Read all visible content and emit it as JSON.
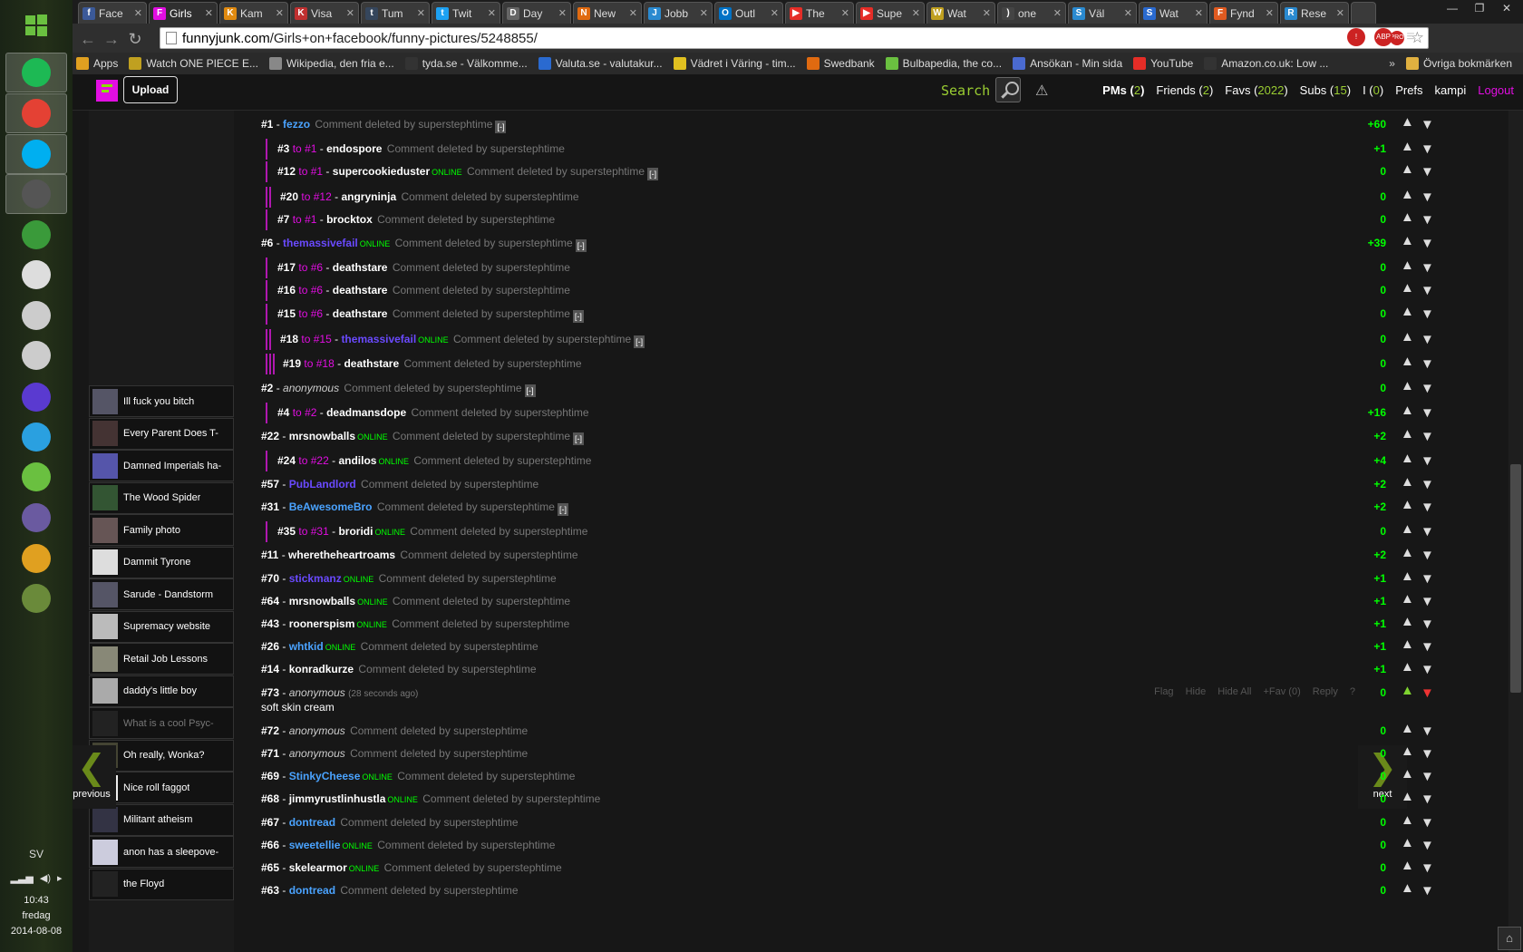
{
  "taskbar": {
    "lang": "SV",
    "time": "10:43",
    "day": "fredag",
    "date": "2014-08-08",
    "apps": [
      {
        "name": "spotify-icon",
        "color": "#1db954"
      },
      {
        "name": "chrome-icon",
        "color": "#e44134"
      },
      {
        "name": "skype-icon",
        "color": "#00aff0"
      },
      {
        "name": "steam-icon",
        "color": "#555555"
      },
      {
        "name": "snes-icon",
        "color": "#3a9a3a"
      },
      {
        "name": "gamepad-icon",
        "color": "#dddddd"
      },
      {
        "name": "dosbox-icon",
        "color": "#cccccc"
      },
      {
        "name": "dosbox2-icon",
        "color": "#cccccc"
      },
      {
        "name": "gba-icon",
        "color": "#5a3ad0"
      },
      {
        "name": "dolphin-icon",
        "color": "#2aa0e0"
      },
      {
        "name": "gamemaker-icon",
        "color": "#6ac040"
      },
      {
        "name": "shield-game-icon",
        "color": "#6a5aa0"
      },
      {
        "name": "rayman-icon",
        "color": "#e0a020"
      },
      {
        "name": "minecraft-icon",
        "color": "#6a8a3a"
      }
    ]
  },
  "browser": {
    "tabs": [
      {
        "label": "Face",
        "icon": "facebook-icon",
        "color": "#3b5998",
        "glyph": "f"
      },
      {
        "label": "Girls",
        "icon": "funnyjunk-icon",
        "color": "#e20ee2",
        "glyph": "F"
      },
      {
        "label": "Kam",
        "icon": "kam-icon",
        "color": "#e08a10",
        "glyph": "K"
      },
      {
        "label": "Visa",
        "icon": "visa-icon",
        "color": "#c03030",
        "glyph": "K"
      },
      {
        "label": "Tum",
        "icon": "tumblr-icon",
        "color": "#35465c",
        "glyph": "t"
      },
      {
        "label": "Twit",
        "icon": "twitter-icon",
        "color": "#1da1f2",
        "glyph": "t"
      },
      {
        "label": "Day",
        "icon": "day-icon",
        "color": "#666666",
        "glyph": "D"
      },
      {
        "label": "New",
        "icon": "ng-icon",
        "color": "#e06a10",
        "glyph": "N"
      },
      {
        "label": "Jobb",
        "icon": "jobb-icon",
        "color": "#2a8ad0",
        "glyph": "J"
      },
      {
        "label": "Outl",
        "icon": "outlook-icon",
        "color": "#0072c6",
        "glyph": "O"
      },
      {
        "label": "The",
        "icon": "youtube-icon",
        "color": "#e52d27",
        "glyph": "▶"
      },
      {
        "label": "Supe",
        "icon": "youtube-icon",
        "color": "#e52d27",
        "glyph": "▶"
      },
      {
        "label": "Wat",
        "icon": "watch-icon",
        "color": "#c0a020",
        "glyph": "W"
      },
      {
        "label": "one",
        "icon": "loading-icon",
        "color": "#444444",
        "glyph": ")"
      },
      {
        "label": "Väl",
        "icon": "smhi-icon",
        "color": "#2a8ad0",
        "glyph": "S"
      },
      {
        "label": "Wat",
        "icon": "watch2-icon",
        "color": "#2a6ad0",
        "glyph": "S"
      },
      {
        "label": "Fynd",
        "icon": "fynd-icon",
        "color": "#e05a20",
        "glyph": "F"
      },
      {
        "label": "Rese",
        "icon": "rese-icon",
        "color": "#2a8ad0",
        "glyph": "R"
      }
    ],
    "url_host": "funnyjunk.com",
    "url_path": "/Girls+on+facebook/funny-pictures/5248855/",
    "pro_badge": "PRO",
    "bookmarks": [
      {
        "label": "Apps",
        "icon": "apps-icon",
        "color": "#e0a020"
      },
      {
        "label": "Watch ONE PIECE E...",
        "icon": "watch-icon",
        "color": "#c0a020"
      },
      {
        "label": "Wikipedia, den fria e...",
        "icon": "wikipedia-icon",
        "color": "#888888"
      },
      {
        "label": "tyda.se - Välkomme...",
        "icon": "tyda-icon",
        "color": "#333333"
      },
      {
        "label": "Valuta.se - valutakur...",
        "icon": "valuta-icon",
        "color": "#2a6ad0"
      },
      {
        "label": "Vädret i Väring - tim...",
        "icon": "weather-icon",
        "color": "#e0c020"
      },
      {
        "label": "Swedbank",
        "icon": "swedbank-icon",
        "color": "#e06a10"
      },
      {
        "label": "Bulbapedia, the co...",
        "icon": "bulbapedia-icon",
        "color": "#6ac040"
      },
      {
        "label": "Ansökan - Min sida",
        "icon": "ansokan-icon",
        "color": "#4a6ad0"
      },
      {
        "label": "YouTube",
        "icon": "youtube-icon",
        "color": "#e52d27"
      },
      {
        "label": "Amazon.co.uk: Low ...",
        "icon": "amazon-icon",
        "color": "#333333"
      }
    ],
    "overflow": "»",
    "other_bookmarks": "Övriga bokmärken"
  },
  "site": {
    "upload_label": "Upload",
    "search_label": "Search",
    "nav": {
      "pms": "PMs (",
      "pms_count": "2",
      "pms_close": ")",
      "friends": "Friends (",
      "friends_count": "2",
      "friends_close": ")",
      "favs": "Favs (",
      "favs_count": "2022",
      "favs_close": ")",
      "subs": "Subs (",
      "subs_count": "15",
      "subs_close": ")",
      "i": "I (",
      "i_count": "0",
      "i_close": ")",
      "prefs": "Prefs",
      "user": "kampi",
      "logout": "Logout"
    }
  },
  "sidebar": {
    "items": [
      {
        "label": "Ill fuck you bitch"
      },
      {
        "label": "Every Parent Does T-"
      },
      {
        "label": "Damned Imperials ha-"
      },
      {
        "label": "The Wood Spider"
      },
      {
        "label": "Family photo"
      },
      {
        "label": "Dammit Tyrone"
      },
      {
        "label": "Sarude - Dandstorm"
      },
      {
        "label": "Supremacy website"
      },
      {
        "label": "Retail Job Lessons"
      },
      {
        "label": "daddy's little boy"
      },
      {
        "label": "What is a cool Psyc-"
      },
      {
        "label": "Oh really, Wonka?"
      },
      {
        "label": "Nice roll faggot"
      },
      {
        "label": "Militant atheism"
      },
      {
        "label": "anon has a sleepove-"
      },
      {
        "label": "the Floyd"
      }
    ],
    "previous": "previous",
    "next": "next"
  },
  "comment_strings": {
    "deleted": "Comment deleted by superstephtime",
    "online": "ONLINE",
    "to": "to",
    "collapse": "[-]",
    "actions": [
      "Flag",
      "Hide",
      "Hide All",
      "+Fav (0)",
      "Reply",
      "?"
    ]
  },
  "comments": [
    {
      "num": "#1",
      "to": "",
      "user": "fezzo",
      "style": "blue",
      "online": false,
      "score": "+60",
      "collapse": true
    },
    {
      "num": "#3",
      "to": "#1",
      "user": "endospore",
      "style": "",
      "online": false,
      "score": "+1",
      "collapse": false
    },
    {
      "num": "#12",
      "to": "#1",
      "user": "supercookieduster",
      "style": "",
      "online": true,
      "score": "0",
      "collapse": true
    },
    {
      "num": "#20",
      "to": "#12",
      "user": "angryninja",
      "style": "",
      "online": false,
      "score": "0",
      "collapse": false
    },
    {
      "num": "#7",
      "to": "#1",
      "user": "brocktox",
      "style": "",
      "online": false,
      "score": "0",
      "collapse": false
    },
    {
      "num": "#6",
      "to": "",
      "user": "themassivefail",
      "style": "purple",
      "online": true,
      "score": "+39",
      "collapse": true
    },
    {
      "num": "#17",
      "to": "#6",
      "user": "deathstare",
      "style": "",
      "online": false,
      "score": "0",
      "collapse": false
    },
    {
      "num": "#16",
      "to": "#6",
      "user": "deathstare",
      "style": "",
      "online": false,
      "score": "0",
      "collapse": false
    },
    {
      "num": "#15",
      "to": "#6",
      "user": "deathstare",
      "style": "",
      "online": false,
      "score": "0",
      "collapse": true
    },
    {
      "num": "#18",
      "to": "#15",
      "user": "themassivefail",
      "style": "purple",
      "online": true,
      "score": "0",
      "collapse": true
    },
    {
      "num": "#19",
      "to": "#18",
      "user": "deathstare",
      "style": "",
      "online": false,
      "score": "0",
      "collapse": false
    },
    {
      "num": "#2",
      "to": "",
      "user": "anonymous",
      "style": "anon",
      "online": false,
      "score": "0",
      "collapse": true
    },
    {
      "num": "#4",
      "to": "#2",
      "user": "deadmansdope",
      "style": "",
      "online": false,
      "score": "+16",
      "collapse": false
    },
    {
      "num": "#22",
      "to": "",
      "user": "mrsnowballs",
      "style": "",
      "online": true,
      "score": "+2",
      "collapse": true
    },
    {
      "num": "#24",
      "to": "#22",
      "user": "andilos",
      "style": "",
      "online": true,
      "score": "+4",
      "collapse": false
    },
    {
      "num": "#57",
      "to": "",
      "user": "PubLandlord",
      "style": "purple",
      "online": false,
      "score": "+2",
      "collapse": false
    },
    {
      "num": "#31",
      "to": "",
      "user": "BeAwesomeBro",
      "style": "blue",
      "online": false,
      "score": "+2",
      "collapse": true
    },
    {
      "num": "#35",
      "to": "#31",
      "user": "broridi",
      "style": "",
      "online": true,
      "score": "0",
      "collapse": false
    },
    {
      "num": "#11",
      "to": "",
      "user": "wheretheheartroams",
      "style": "",
      "online": false,
      "score": "+2",
      "collapse": false
    },
    {
      "num": "#70",
      "to": "",
      "user": "stickmanz",
      "style": "purple",
      "online": true,
      "score": "+1",
      "collapse": false
    },
    {
      "num": "#64",
      "to": "",
      "user": "mrsnowballs",
      "style": "",
      "online": true,
      "score": "+1",
      "collapse": false
    },
    {
      "num": "#43",
      "to": "",
      "user": "roonerspism",
      "style": "",
      "online": true,
      "score": "+1",
      "collapse": false
    },
    {
      "num": "#26",
      "to": "",
      "user": "whtkid",
      "style": "blue",
      "online": true,
      "score": "+1",
      "collapse": false
    },
    {
      "num": "#14",
      "to": "",
      "user": "konradkurze",
      "style": "",
      "online": false,
      "score": "+1",
      "collapse": false
    },
    {
      "num": "#73",
      "to": "",
      "user": "anonymous",
      "style": "anon",
      "online": false,
      "score": "0",
      "collapse": false,
      "ago": "(28 seconds ago)",
      "text": "soft skin cream",
      "live": true
    },
    {
      "num": "#72",
      "to": "",
      "user": "anonymous",
      "style": "anon",
      "online": false,
      "score": "0",
      "collapse": false
    },
    {
      "num": "#71",
      "to": "",
      "user": "anonymous",
      "style": "anon",
      "online": false,
      "score": "0",
      "collapse": false
    },
    {
      "num": "#69",
      "to": "",
      "user": "StinkyCheese",
      "style": "blue",
      "online": true,
      "score": "0",
      "collapse": false
    },
    {
      "num": "#68",
      "to": "",
      "user": "jimmyrustlinhustla",
      "style": "",
      "online": true,
      "score": "0",
      "collapse": false
    },
    {
      "num": "#67",
      "to": "",
      "user": "dontread",
      "style": "blue",
      "online": false,
      "score": "0",
      "collapse": false
    },
    {
      "num": "#66",
      "to": "",
      "user": "sweetellie",
      "style": "blue",
      "online": true,
      "score": "0",
      "collapse": false
    },
    {
      "num": "#65",
      "to": "",
      "user": "skelearmor",
      "style": "",
      "online": true,
      "score": "0",
      "collapse": false
    },
    {
      "num": "#63",
      "to": "",
      "user": "dontread",
      "style": "blue",
      "online": false,
      "score": "0",
      "collapse": false
    }
  ]
}
